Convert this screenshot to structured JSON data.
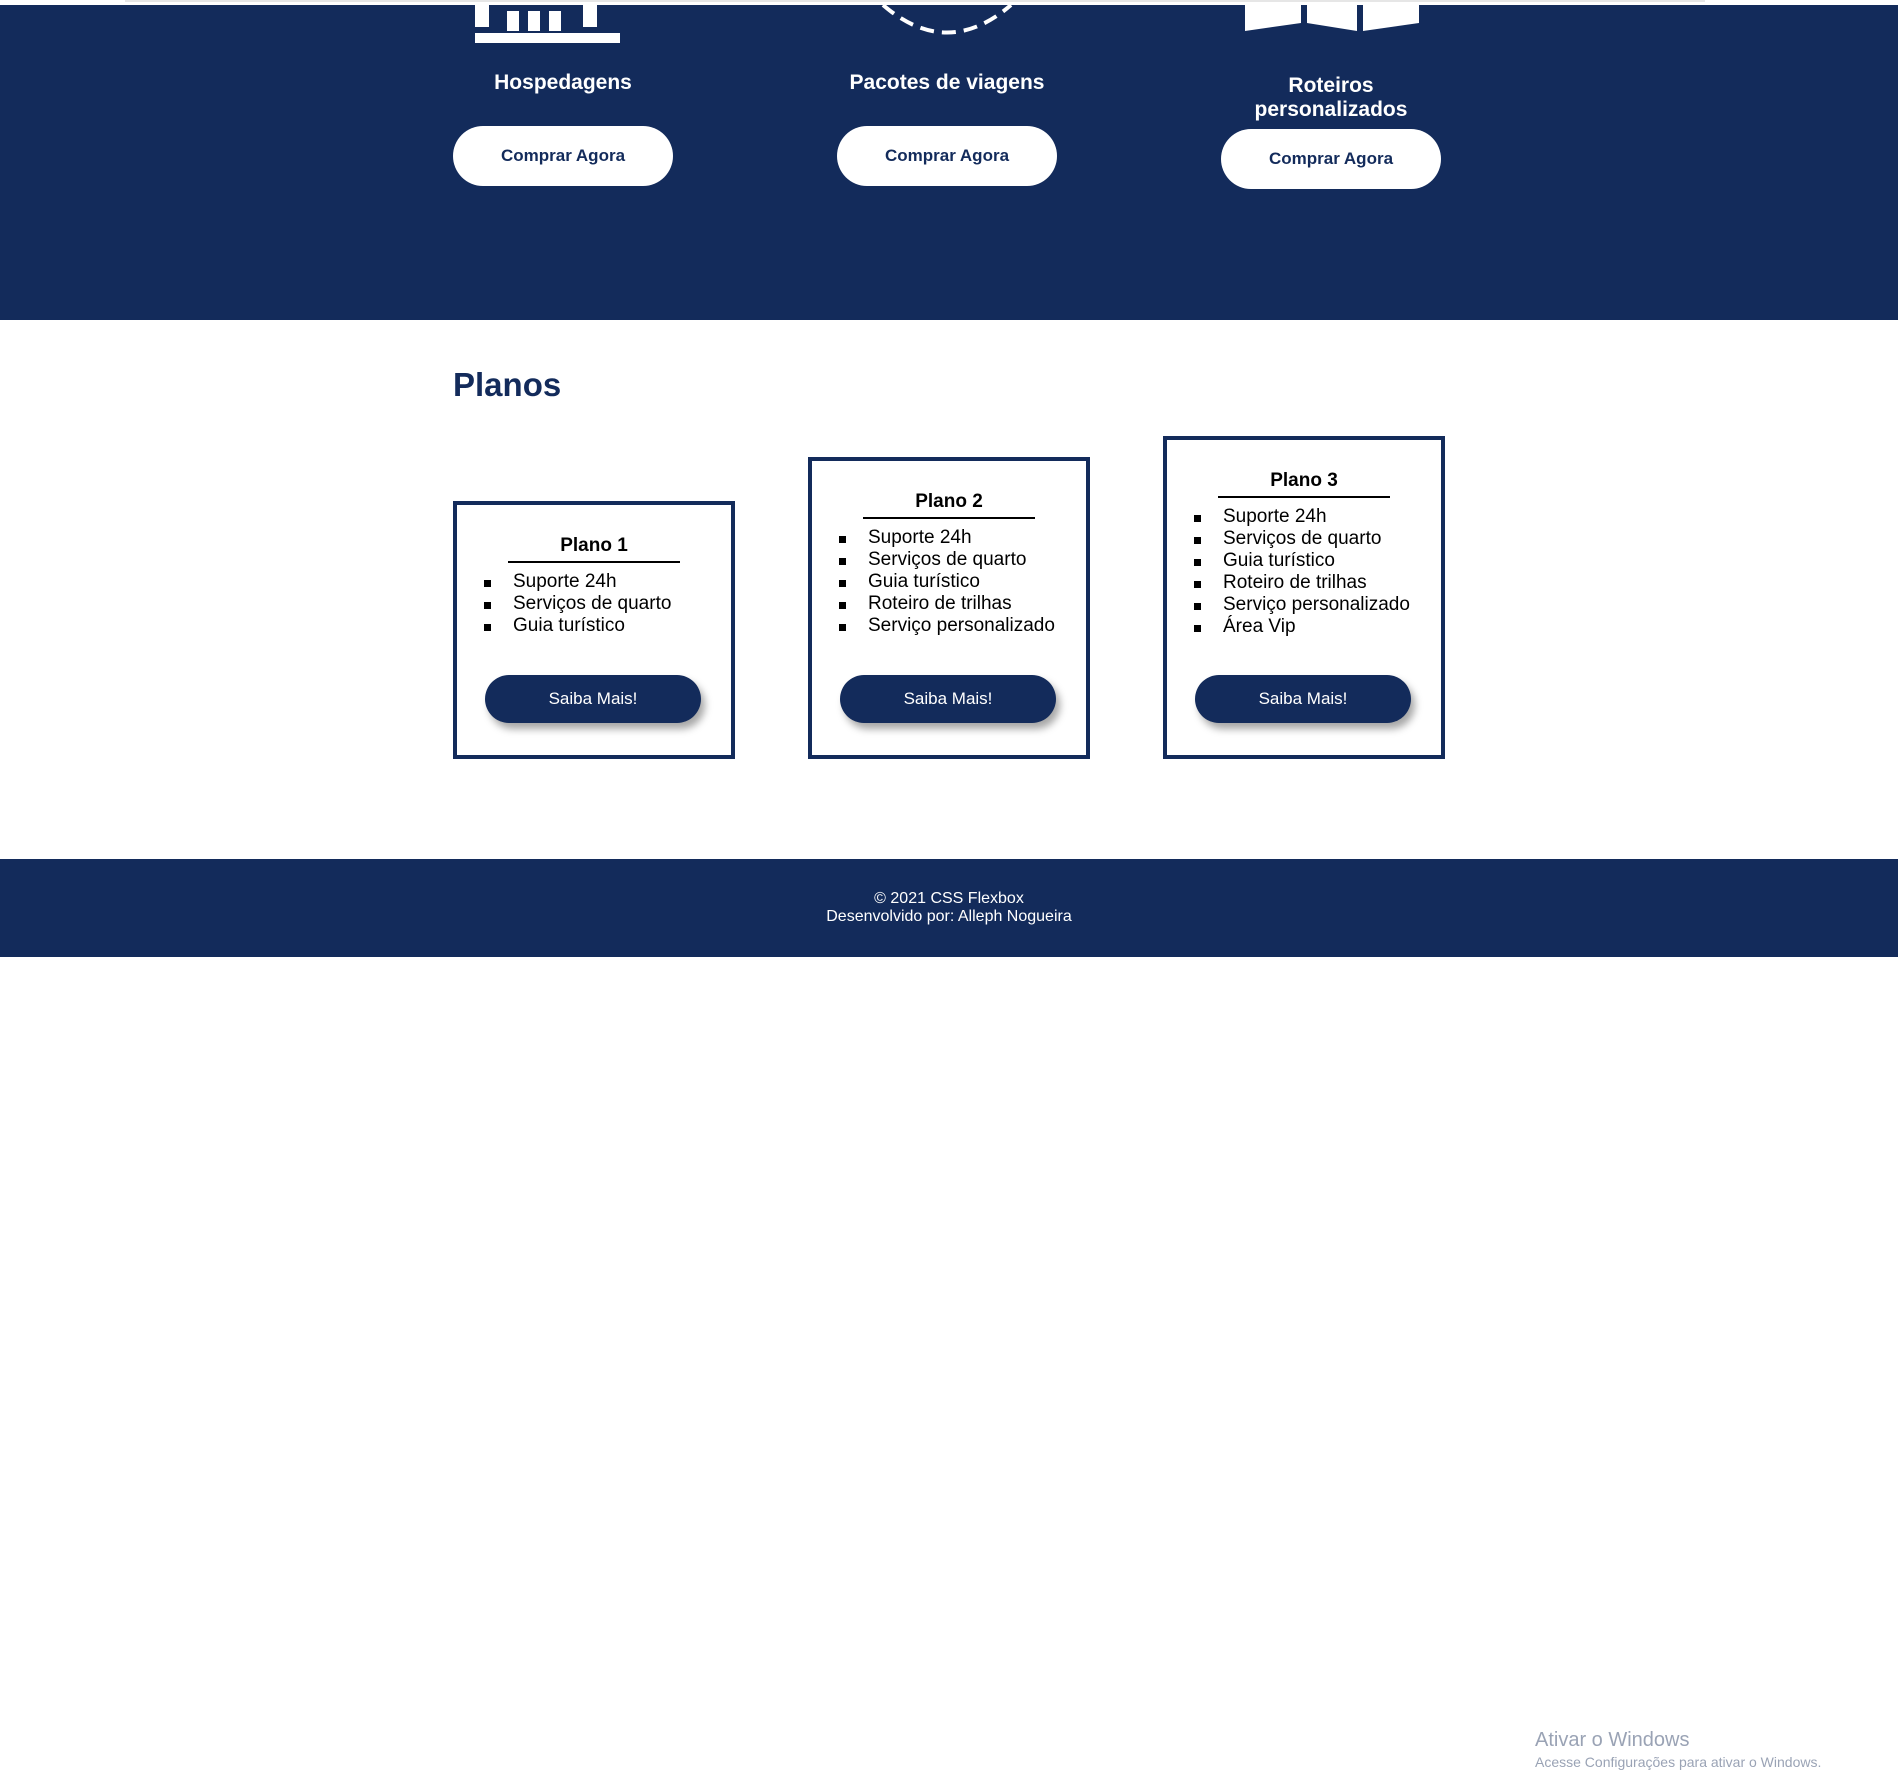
{
  "services": [
    {
      "title": "Hospedagens",
      "button": "Comprar Agora",
      "icon": "building-icon"
    },
    {
      "title": "Pacotes de viagens",
      "button": "Comprar Agora",
      "icon": "globe-icon"
    },
    {
      "title": "Roteiros personalizados",
      "button": "Comprar Agora",
      "icon": "map-icon"
    }
  ],
  "plans_section": {
    "title": "Planos"
  },
  "plans": [
    {
      "name": "Plano 1",
      "features": [
        "Suporte 24h",
        "Serviços de quarto",
        "Guia turístico"
      ],
      "button": "Saiba Mais!"
    },
    {
      "name": "Plano 2",
      "features": [
        "Suporte 24h",
        "Serviços de quarto",
        "Guia turístico",
        "Roteiro de trilhas",
        "Serviço personalizado"
      ],
      "button": "Saiba Mais!"
    },
    {
      "name": "Plano 3",
      "features": [
        "Suporte 24h",
        "Serviços de quarto",
        "Guia turístico",
        "Roteiro de trilhas",
        "Serviço personalizado",
        "Área Vip"
      ],
      "button": "Saiba Mais!"
    }
  ],
  "footer": {
    "copyright": "© 2021 CSS Flexbox",
    "credits": "Desenvolvido por: Alleph Nogueira"
  },
  "watermark": {
    "title": "Ativar o Windows",
    "subtitle": "Acesse Configurações para ativar o Windows."
  },
  "colors": {
    "brand": "#132b5b",
    "background": "#ffffff"
  }
}
